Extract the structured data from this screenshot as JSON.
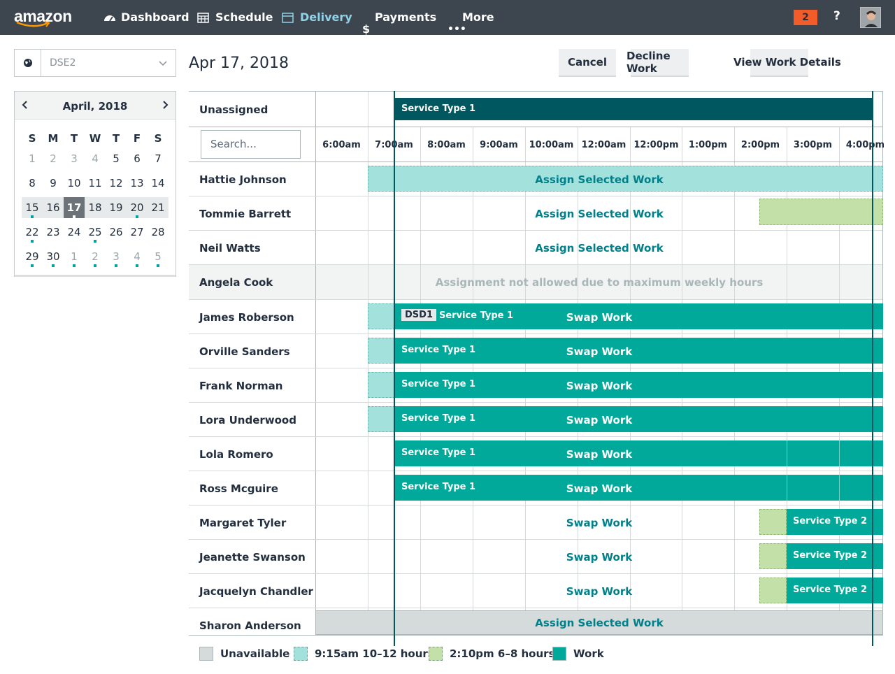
{
  "topnav": {
    "logo": "amazon",
    "items": [
      {
        "label": "Dashboard",
        "icon": "dashboard-icon"
      },
      {
        "label": "Schedule",
        "icon": "calendar-grid-icon"
      },
      {
        "label": "Delivery",
        "icon": "calendar-icon",
        "active": true
      },
      {
        "label": "Payments",
        "icon": "dollar-icon"
      },
      {
        "label": "More",
        "icon": "more-icon"
      }
    ],
    "notifications": "2",
    "help": "?"
  },
  "station": {
    "value": "DSE2"
  },
  "calendar": {
    "title": "April, 2018",
    "weekdays": [
      "S",
      "M",
      "T",
      "W",
      "T",
      "F",
      "S"
    ],
    "weeks": [
      [
        "1",
        "2",
        "3",
        "4",
        "5",
        "6",
        "7"
      ],
      [
        "8",
        "9",
        "10",
        "11",
        "12",
        "13",
        "14"
      ],
      [
        "15",
        "16",
        "17",
        "18",
        "19",
        "20",
        "21"
      ],
      [
        "22",
        "23",
        "24",
        "25",
        "26",
        "27",
        "28"
      ],
      [
        "29",
        "30",
        "1",
        "2",
        "3",
        "4",
        "5"
      ]
    ],
    "selected": "17"
  },
  "header": {
    "date": "Apr 17, 2018",
    "cancel": "Cancel",
    "decline": "Decline Work",
    "details": "View Work Details"
  },
  "grid": {
    "unassigned_label": "Unassigned",
    "unassigned_bar": "Service Type 1",
    "search_placeholder": "Search...",
    "times": [
      "6:00am",
      "7:00am",
      "8:00am",
      "9:00am",
      "10:00am",
      "12:00am",
      "12:00pm",
      "1:00pm",
      "2:00pm",
      "3:00pm",
      "4:00pm"
    ],
    "rows": [
      {
        "name": "Hattie Johnson",
        "action": "Assign Selected Work"
      },
      {
        "name": "Tommie Barrett",
        "action": "Assign Selected Work"
      },
      {
        "name": "Neil Watts",
        "action": "Assign Selected Work"
      },
      {
        "name": "Angela Cook",
        "action": "Assignment not allowed due to maximum weekly hours"
      },
      {
        "name": "James Roberson",
        "action": "Swap Work",
        "badge": "DSD1",
        "bar": "Service Type 1"
      },
      {
        "name": "Orville Sanders",
        "action": "Swap Work",
        "bar": "Service Type 1"
      },
      {
        "name": "Frank Norman",
        "action": "Swap Work",
        "bar": "Service Type 1"
      },
      {
        "name": "Lora Underwood",
        "action": "Swap Work",
        "bar": "Service Type 1"
      },
      {
        "name": "Lola Romero",
        "action": "Swap Work",
        "bar": "Service Type 1"
      },
      {
        "name": "Ross Mcguire",
        "action": "Swap Work",
        "bar": "Service Type 1"
      },
      {
        "name": "Margaret Tyler",
        "action": "Swap Work",
        "bar": "Service Type 2"
      },
      {
        "name": "Jeanette Swanson",
        "action": "Swap Work",
        "bar": "Service Type 2"
      },
      {
        "name": "Jacquelyn Chandler",
        "action": "Swap Work",
        "bar": "Service Type 2"
      },
      {
        "name": "Sharon Anderson",
        "action": "Assign Selected Work"
      }
    ]
  },
  "legend": [
    {
      "label": "Unavailable",
      "color": "#d5dbdb"
    },
    {
      "label": "9:15am 10–12 hours",
      "color": "#a3e1dc"
    },
    {
      "label": "2:10pm 6–8 hours",
      "color": "#c2e0a8"
    },
    {
      "label": "Work",
      "color": "#00a99a"
    }
  ],
  "colors": {
    "nav": "#3d454f",
    "work": "#00a99a",
    "unassigned": "#00575f",
    "action": "#00808a"
  }
}
